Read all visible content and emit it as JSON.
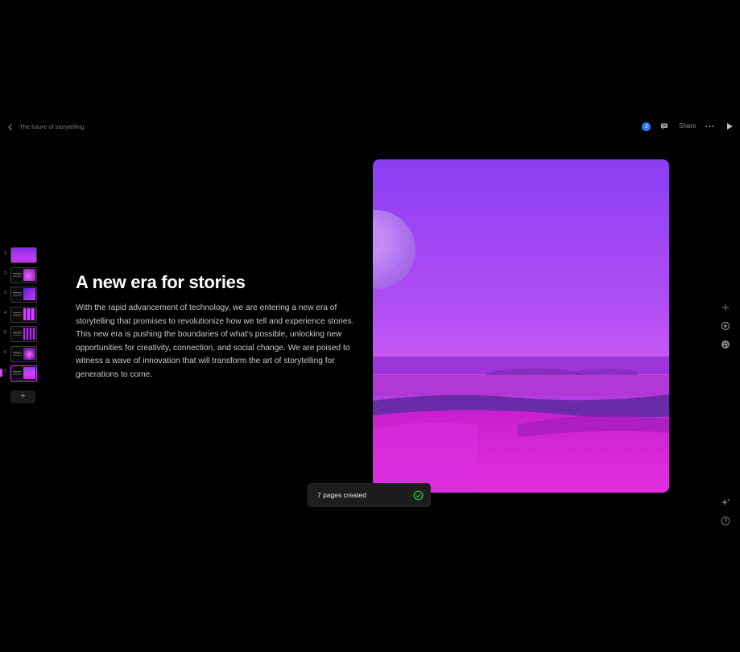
{
  "header": {
    "title": "The future of storytelling",
    "avatar_initial": "J",
    "share_label": "Share"
  },
  "thumbnails": [
    {
      "number": "1",
      "active": false
    },
    {
      "number": "2",
      "active": false
    },
    {
      "number": "3",
      "active": false
    },
    {
      "number": "4",
      "active": false
    },
    {
      "number": "5",
      "active": false
    },
    {
      "number": "6",
      "active": false
    },
    {
      "number": "7",
      "active": true
    }
  ],
  "add_page_label": "+",
  "slide": {
    "heading": "A new era for stories",
    "body": "With the rapid advancement of technology, we are entering a new era of storytelling that promises to revolutionize how we tell and experience stories. This new era is pushing the boundaries of what's possible, unlocking new opportunities for creativity, connection, and social change. We are poised to witness a wave of innovation that will transform the art of storytelling for generations to come."
  },
  "toast": {
    "message": "7 pages created"
  },
  "colors": {
    "accent": "#e141ff",
    "avatar": "#2f7cf6",
    "success": "#2ecc5a"
  },
  "icons": [
    "chevron-left-icon",
    "comment-icon",
    "more-icon",
    "play-icon",
    "plus-icon",
    "target-icon",
    "palette-icon",
    "sparkle-icon",
    "help-icon",
    "check-circle-icon"
  ]
}
